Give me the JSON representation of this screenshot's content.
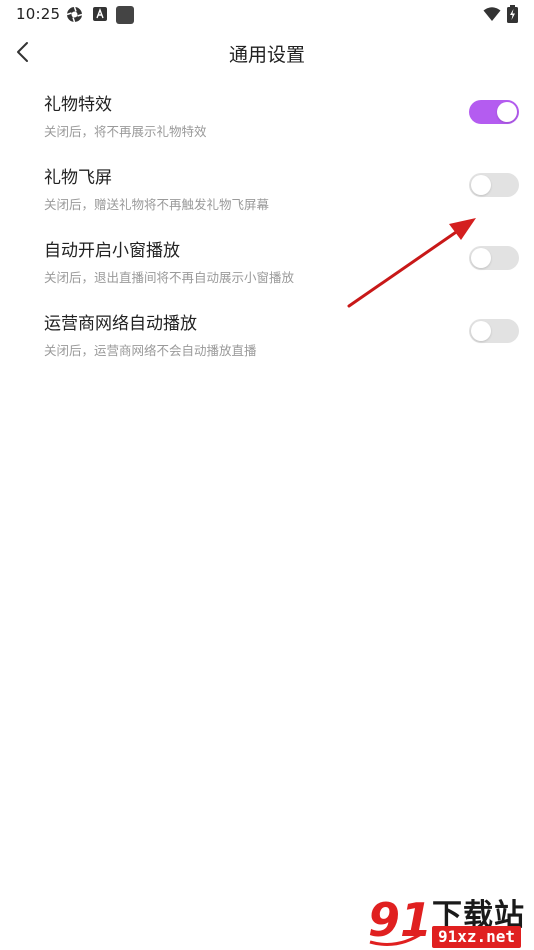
{
  "status_bar": {
    "time": "10:25"
  },
  "app_bar": {
    "title": "通用设置"
  },
  "settings": [
    {
      "title": "礼物特效",
      "desc": "关闭后，将不再展示礼物特效",
      "enabled": true
    },
    {
      "title": "礼物飞屏",
      "desc": "关闭后，赠送礼物将不再触发礼物飞屏幕",
      "enabled": false
    },
    {
      "title": "自动开启小窗播放",
      "desc": "关闭后，退出直播间将不再自动展示小窗播放",
      "enabled": false
    },
    {
      "title": "运营商网络自动播放",
      "desc": "关闭后，运营商网络不会自动播放直播",
      "enabled": false
    }
  ],
  "icons": {
    "back": "chevron-left-icon",
    "wifi": "wifi-icon",
    "battery": "battery-charging-icon",
    "app1": "aperture-icon",
    "app2": "font-a-icon",
    "app3": "square-icon"
  },
  "colors": {
    "toggle_on": "#b45cf0",
    "toggle_off": "#e2e2e2",
    "arrow": "#d41f1f"
  },
  "watermark": {
    "title": "下载站",
    "domain": "91xz.net",
    "logo_text": "91"
  }
}
